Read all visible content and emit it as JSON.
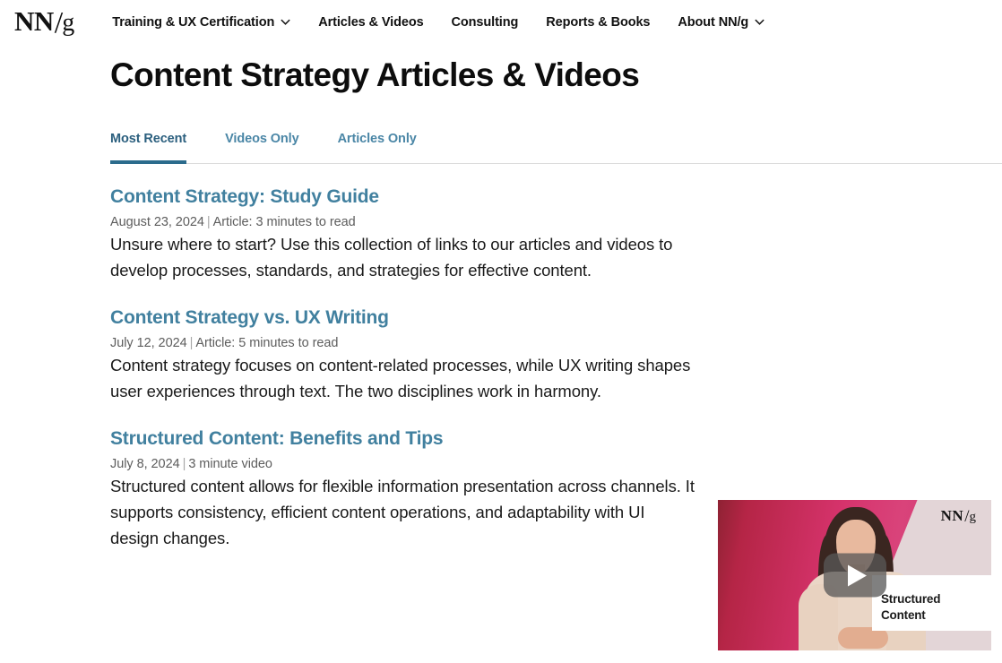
{
  "header": {
    "logo": {
      "nn": "NN",
      "slash": "/",
      "g": "g",
      "alt": "NN/g"
    },
    "nav": [
      {
        "label": "Training & UX Certification",
        "has_dropdown": true
      },
      {
        "label": "Articles & Videos",
        "has_dropdown": false
      },
      {
        "label": "Consulting",
        "has_dropdown": false
      },
      {
        "label": "Reports & Books",
        "has_dropdown": false
      },
      {
        "label": "About NN/g",
        "has_dropdown": true
      }
    ]
  },
  "page": {
    "title": "Content Strategy Articles & Videos"
  },
  "tabs": [
    {
      "label": "Most Recent",
      "active": true
    },
    {
      "label": "Videos Only",
      "active": false
    },
    {
      "label": "Articles Only",
      "active": false
    }
  ],
  "articles": [
    {
      "title": "Content Strategy: Study Guide",
      "date": "August 23, 2024",
      "separator": "|",
      "type": "Article: 3 minutes to read",
      "description": "Unsure where to start? Use this collection of links to our articles and videos to develop processes, standards, and strategies for effective content."
    },
    {
      "title": "Content Strategy vs. UX Writing",
      "date": "July 12, 2024",
      "separator": "|",
      "type": "Article: 5 minutes to read",
      "description": "Content strategy focuses on content-related processes, while UX writing shapes user experiences through text. The two disciplines work in harmony."
    },
    {
      "title": "Structured Content: Benefits and Tips",
      "date": "July 8, 2024",
      "separator": "|",
      "type": "3 minute video",
      "description": "Structured content allows for flexible information presentation across channels. It supports consistency, efficient content operations, and adaptability with UI design changes."
    }
  ],
  "video_thumbnail": {
    "caption_line1": "Structured",
    "caption_line2": "Content",
    "logo_nn": "NN",
    "logo_slash": "/",
    "logo_g": "g",
    "play_label": "Play video"
  },
  "colors": {
    "link_blue": "#41809f",
    "tab_blue": "#4a86a6",
    "tab_active_blue": "#2b5f7e",
    "tab_underline": "#2b6b8c",
    "meta_grey": "#5d5d5d",
    "body_text": "#1a1a1a",
    "rule_grey": "#dcdcdc",
    "thumb_pink": "#d6336c",
    "thumb_maroon": "#8e2233",
    "thumb_band": "#e3d5d7"
  }
}
